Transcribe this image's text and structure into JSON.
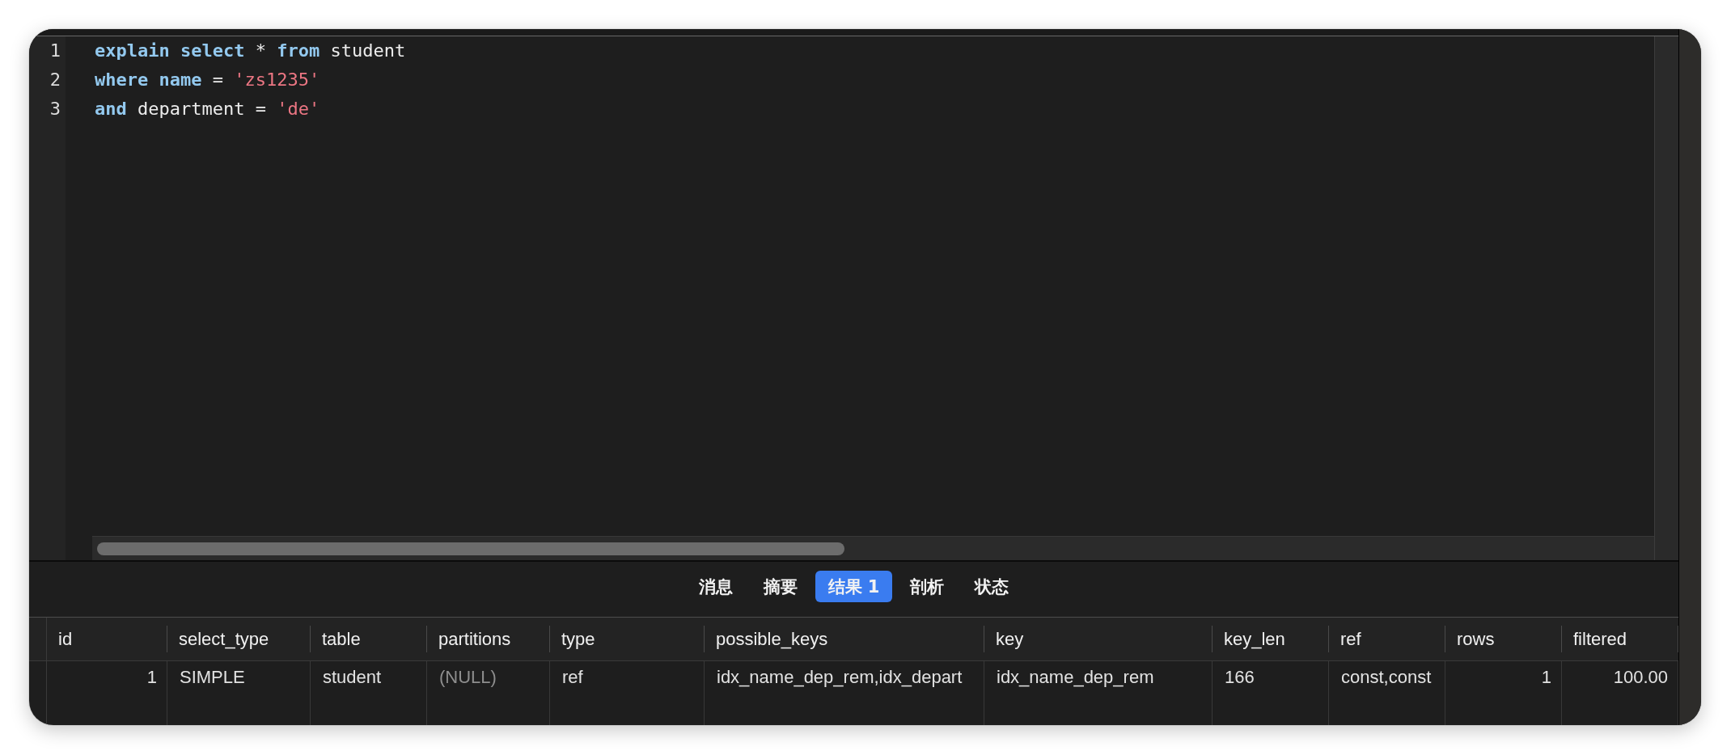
{
  "editor": {
    "lines": [
      {
        "number": "1",
        "tokens": [
          {
            "kind": "keyword",
            "text": "explain"
          },
          {
            "kind": "keyword",
            "text": " select"
          },
          {
            "kind": "plain",
            "text": " * "
          },
          {
            "kind": "keyword",
            "text": "from"
          },
          {
            "kind": "plain",
            "text": " student"
          }
        ]
      },
      {
        "number": "2",
        "tokens": [
          {
            "kind": "keyword",
            "text": "where"
          },
          {
            "kind": "keyword",
            "text": " name"
          },
          {
            "kind": "plain",
            "text": " = "
          },
          {
            "kind": "string",
            "text": "'zs1235'"
          }
        ]
      },
      {
        "number": "3",
        "tokens": [
          {
            "kind": "keyword",
            "text": "and"
          },
          {
            "kind": "plain",
            "text": " department = "
          },
          {
            "kind": "string",
            "text": "'de'"
          }
        ]
      }
    ]
  },
  "result_tabs": [
    {
      "label": "消息",
      "selected": false
    },
    {
      "label": "摘要",
      "selected": false
    },
    {
      "label": "结果 1",
      "selected": true
    },
    {
      "label": "剖析",
      "selected": false
    },
    {
      "label": "状态",
      "selected": false
    }
  ],
  "table": {
    "columns": [
      {
        "label": "id",
        "kind": "number"
      },
      {
        "label": "select_type",
        "kind": "text"
      },
      {
        "label": "table",
        "kind": "text"
      },
      {
        "label": "partitions",
        "kind": "text"
      },
      {
        "label": "type",
        "kind": "text"
      },
      {
        "label": "possible_keys",
        "kind": "text"
      },
      {
        "label": "key",
        "kind": "text"
      },
      {
        "label": "key_len",
        "kind": "text"
      },
      {
        "label": "ref",
        "kind": "text"
      },
      {
        "label": "rows",
        "kind": "number"
      },
      {
        "label": "filtered",
        "kind": "number"
      }
    ],
    "rows": [
      {
        "cells": [
          {
            "text": "1",
            "kind": "value"
          },
          {
            "text": "SIMPLE",
            "kind": "value"
          },
          {
            "text": "student",
            "kind": "value"
          },
          {
            "text": "(NULL)",
            "kind": "null"
          },
          {
            "text": "ref",
            "kind": "value"
          },
          {
            "text": "idx_name_dep_rem,idx_depart",
            "kind": "value"
          },
          {
            "text": "idx_name_dep_rem",
            "kind": "value"
          },
          {
            "text": "166",
            "kind": "value"
          },
          {
            "text": "const,const",
            "kind": "value"
          },
          {
            "text": "1",
            "kind": "value"
          },
          {
            "text": "100.00",
            "kind": "value"
          }
        ]
      }
    ]
  }
}
